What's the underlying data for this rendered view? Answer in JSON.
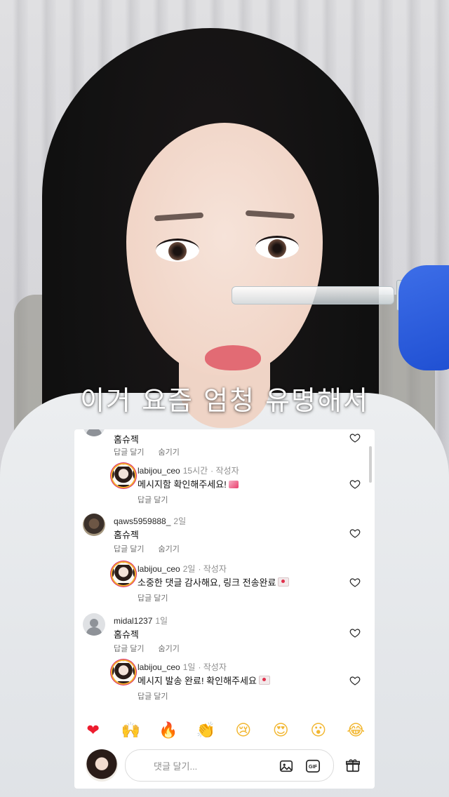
{
  "video": {
    "caption": "이거 요즘 엄청 유명해서"
  },
  "comments": [
    {
      "kind": "reply-top",
      "username": "",
      "time": "",
      "text": "홈슈젝",
      "actions": [
        "답글 달기",
        "숨기기"
      ]
    },
    {
      "kind": "reply",
      "username": "labijou_ceo",
      "time": "15시간",
      "badge": "· 작성자",
      "text": "메시지함 확인해주세요!",
      "emoji": "gift",
      "actions": [
        "답글 달기"
      ]
    },
    {
      "kind": "comment",
      "username": "qaws5959888_",
      "time": "2일",
      "text": "홈슈젝",
      "actions": [
        "답글 달기",
        "숨기기"
      ]
    },
    {
      "kind": "reply",
      "username": "labijou_ceo",
      "time": "2일",
      "badge": "· 작성자",
      "text": "소중한 댓글 감사해요, 링크 전송완료",
      "emoji": "envelope",
      "actions": [
        "답글 달기"
      ]
    },
    {
      "kind": "comment",
      "username": "midal1237",
      "time": "1일",
      "text": "홈슈젝",
      "actions": [
        "답글 달기",
        "숨기기"
      ]
    },
    {
      "kind": "reply",
      "username": "labijou_ceo",
      "time": "1일",
      "badge": "· 작성자",
      "text": "메시지 발송 완료! 확인해주세요",
      "emoji": "envelope",
      "actions": [
        "답글 달기"
      ]
    }
  ],
  "quick_emojis": [
    {
      "name": "red-heart",
      "glyph": "❤"
    },
    {
      "name": "raised-hands",
      "glyph": "🙌"
    },
    {
      "name": "fire",
      "glyph": "🔥"
    },
    {
      "name": "clapping-hands",
      "glyph": "👏"
    },
    {
      "name": "crying-face",
      "glyph": "😢"
    },
    {
      "name": "heart-eyes",
      "glyph": "😍"
    },
    {
      "name": "surprised-face",
      "glyph": "😮"
    },
    {
      "name": "tears-of-joy",
      "glyph": "😂"
    }
  ],
  "composer": {
    "placeholder": "댓글 달기...",
    "icons": [
      "image-icon",
      "gif-icon",
      "gift-icon"
    ],
    "gif_label": "GIF"
  },
  "colors": {
    "heart_red": "#ed1c2e",
    "text_primary": "#262626",
    "text_secondary": "#8e8e8e"
  }
}
